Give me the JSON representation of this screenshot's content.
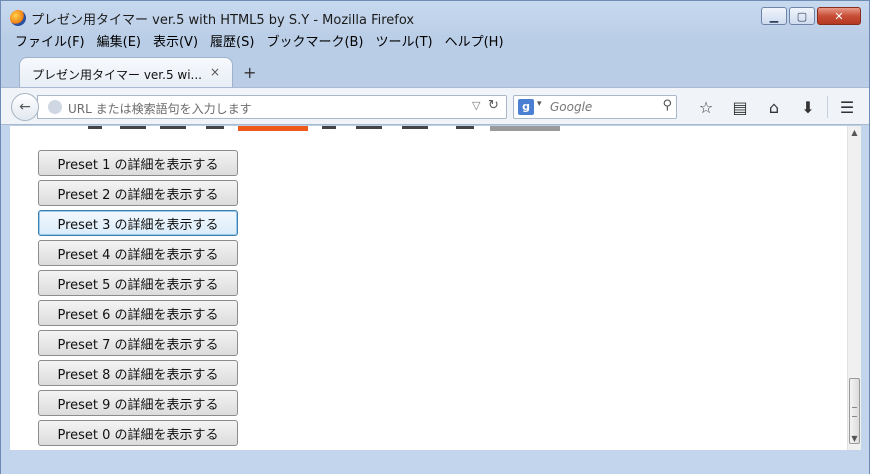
{
  "window": {
    "title": "プレゼン用タイマー ver.5 with HTML5 by S.Y - Mozilla Firefox"
  },
  "menubar": {
    "items": [
      "ファイル(F)",
      "編集(E)",
      "表示(V)",
      "履歴(S)",
      "ブックマーク(B)",
      "ツール(T)",
      "ヘルプ(H)"
    ]
  },
  "tab": {
    "label": "プレゼン用タイマー ver.5 wi...",
    "close": "×",
    "newtab": "+"
  },
  "navbar": {
    "url_placeholder": "URL または検索語句を入力します",
    "search_engine": "g",
    "search_placeholder": "Google"
  },
  "presets": [
    {
      "label": "Preset 1 の詳細を表示する",
      "focused": false
    },
    {
      "label": "Preset 2 の詳細を表示する",
      "focused": false
    },
    {
      "label": "Preset 3 の詳細を表示する",
      "focused": true
    },
    {
      "label": "Preset 4 の詳細を表示する",
      "focused": false
    },
    {
      "label": "Preset 5 の詳細を表示する",
      "focused": false
    },
    {
      "label": "Preset 6 の詳細を表示する",
      "focused": false
    },
    {
      "label": "Preset 7 の詳細を表示する",
      "focused": false
    },
    {
      "label": "Preset 8 の詳細を表示する",
      "focused": false
    },
    {
      "label": "Preset 9 の詳細を表示する",
      "focused": false
    },
    {
      "label": "Preset 0 の詳細を表示する",
      "focused": false
    }
  ],
  "colors": {
    "accent_orange": "#ef5a1a",
    "accent_gray": "#9a9a9a"
  }
}
